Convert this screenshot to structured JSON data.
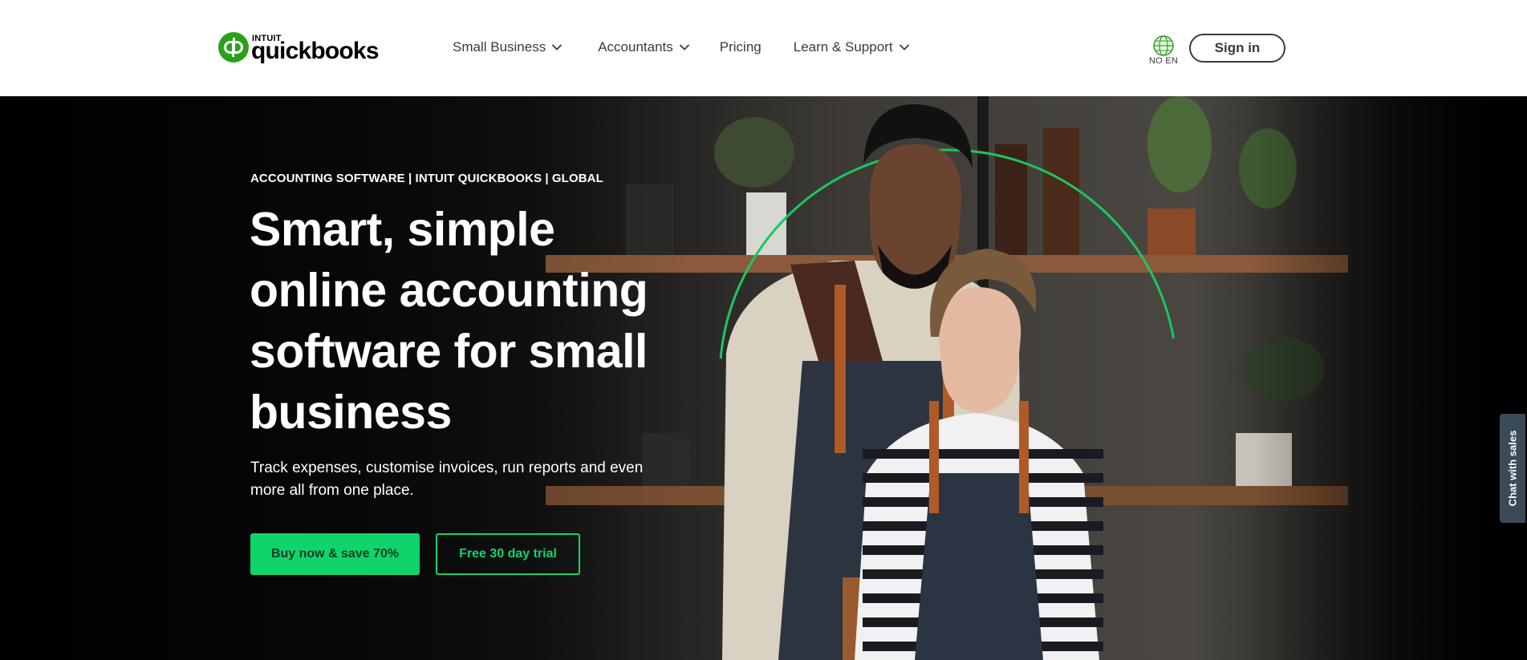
{
  "brand": {
    "company": "INTUIT",
    "product": "quickbooks",
    "color": "#2ca01c"
  },
  "nav": {
    "items": [
      {
        "label": "Small Business",
        "has_dropdown": true
      },
      {
        "label": "Accountants",
        "has_dropdown": true
      },
      {
        "label": "Pricing",
        "has_dropdown": false
      },
      {
        "label": "Learn & Support",
        "has_dropdown": true
      }
    ],
    "locale": "NO EN",
    "locale_icon": "globe-icon",
    "sign_in": "Sign in"
  },
  "hero": {
    "eyebrow": "ACCOUNTING SOFTWARE | INTUIT QUICKBOOKS | GLOBAL",
    "headline": "Smart, simple online accounting software for small business",
    "subtext": "Track expenses, customise invoices, run reports and even more all from one place.",
    "primary_cta": "Buy now & save 70%",
    "secondary_cta": "Free 30 day trial",
    "accent_color": "#0fd46c"
  },
  "chat": {
    "label": "Chat with sales"
  }
}
